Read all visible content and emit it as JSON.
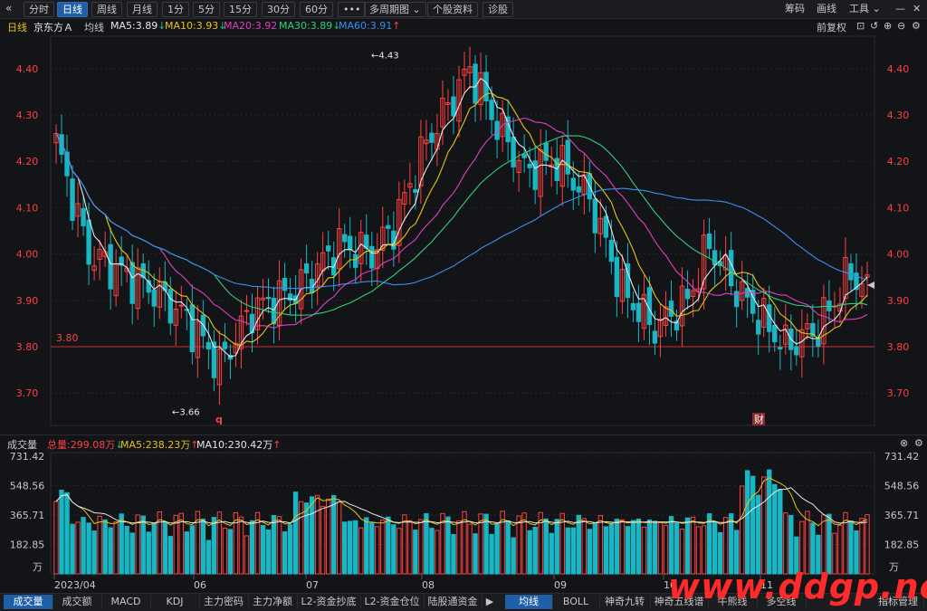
{
  "toolbar": {
    "collapse_icon": "«",
    "buttons": [
      "分时",
      "日线",
      "周线",
      "月线",
      "1分",
      "5分",
      "15分",
      "30分",
      "60分",
      "•••",
      "多周期图",
      "个股资料",
      "诊股"
    ],
    "active": "日线",
    "right": [
      "筹码",
      "画线",
      "工具"
    ],
    "window_controls": [
      "minimize-icon",
      "maximize-icon",
      "close-icon"
    ]
  },
  "infobar": {
    "period": "日线",
    "stock": "京东方Ａ",
    "avg": "均线",
    "ma": [
      {
        "label": "MA5:3.89",
        "arrow": "↓",
        "color": "#e8e8e8",
        "arrow_color": "#1fc27a"
      },
      {
        "label": "MA10:3.93",
        "arrow": "↓",
        "color": "#e6c419",
        "arrow_color": "#1fc27a"
      },
      {
        "label": "MA20:3.92",
        "arrow": "",
        "color": "#e040c0",
        "arrow_color": ""
      },
      {
        "label": "MA30:3.89",
        "arrow": "↓",
        "color": "#2fd07a",
        "arrow_color": "#1fc27a"
      },
      {
        "label": "MA60:3.91",
        "arrow": "↑",
        "color": "#3a8ef0",
        "arrow_color": "#ff4040"
      }
    ],
    "fq": "前复权",
    "icons": [
      "lock-icon",
      "undo-icon",
      "zoom-in-icon",
      "zoom-out-icon",
      "settings-icon"
    ]
  },
  "chart_data": {
    "type": "candlestick",
    "price_axis": {
      "ticks": [
        "4.40",
        "4.30",
        "4.20",
        "4.10",
        "4.00",
        "3.90",
        "3.80",
        "3.70"
      ],
      "range": [
        3.63,
        4.47
      ]
    },
    "reference_line": {
      "value": 3.8,
      "label": "3.80"
    },
    "annotations": [
      {
        "label": "4.43",
        "value": 4.43
      },
      {
        "label": "3.66",
        "value": 3.66
      }
    ],
    "event_markers": [
      "q",
      "财"
    ],
    "x_ticks": [
      "2023/04",
      "06",
      "07",
      "08",
      "09",
      "10",
      "11"
    ],
    "colors": {
      "up": "#ff4040",
      "down": "#19b6c4",
      "ma5": "#e8e8e8",
      "ma10": "#e6c419",
      "ma20": "#e040c0",
      "ma30": "#2fd07a",
      "ma60": "#3a8ef0"
    }
  },
  "volume": {
    "label": "成交量",
    "total": "总量:299.08万",
    "total_arrow": "↓",
    "ma5": "MA5:238.23万",
    "ma5_arrow": "↑",
    "ma10": "MA10:230.42万",
    "ma10_arrow": "↑",
    "axis": {
      "ticks": [
        "731.42",
        "548.56",
        "365.71",
        "182.85"
      ],
      "unit": "万",
      "max": 731.42
    }
  },
  "bottom_tabs_left": [
    "成交量",
    "成交额",
    "MACD",
    "KDJ",
    "主力密码",
    "主力净额",
    "L2-资金抄底",
    "L2-资金仓位",
    "陆股通资金"
  ],
  "bottom_tabs_right": [
    "均线",
    "BOLL",
    "神奇九转",
    "神奇五线谱",
    "牛熊线",
    "多空线",
    "指标管理"
  ],
  "bottom_active_left": "成交量",
  "bottom_active_right": "均线",
  "watermark": "www.ddgp.net"
}
